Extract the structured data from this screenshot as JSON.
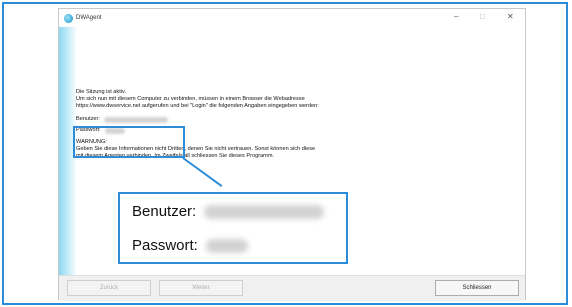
{
  "window": {
    "title": "DWAgent",
    "controls": {
      "minimize": "–",
      "maximize": "□",
      "close": "✕"
    }
  },
  "content": {
    "line1": "Die Sitzung ist aktiv.",
    "line2": "Um sich nun mit diesem Computer zu verbinden, müssen in einem Browser die Webadresse",
    "line3": "https://www.dwservice.net aufgerufen und bei \"Login\" die folgenden Angaben eingegeben werden:",
    "user_label": "Benutzer:",
    "password_label": "Passwort:",
    "warning_title": "WARNUNG:",
    "warning_line1": "Geben Sie diese Informationen nicht Dritten, denen Sie nicht vertrauen. Sonst können sich diese",
    "warning_line2": "mit diesem Agenten verbinden. Im Zweifelsfall schliessen Sie dieses Programm."
  },
  "callout": {
    "user_label": "Benutzer:",
    "password_label": "Passwort:"
  },
  "buttons": {
    "back": "Zurück",
    "next": "Weiter",
    "close": "Schliessen"
  },
  "colors": {
    "accent": "#2b8cd9"
  }
}
